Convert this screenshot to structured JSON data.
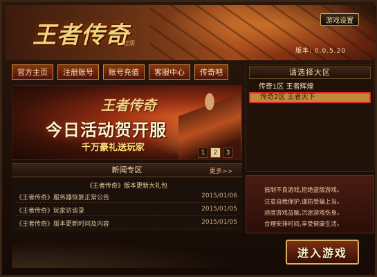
{
  "header": {
    "logo": "王者传奇",
    "logo_sub": "正版",
    "settings_label": "游戏设置",
    "version": "版本: 0.0.5.20"
  },
  "nav": {
    "items": [
      "官方主页",
      "注册账号",
      "账号充值",
      "客服中心",
      "传奇吧"
    ]
  },
  "banner": {
    "logo": "王者传奇",
    "headline": "今日活动贺开服",
    "subtitle": "千万豪礼送玩家",
    "pages": [
      "1",
      "2",
      "3"
    ],
    "active_page": 2
  },
  "news": {
    "title": "新闻专区",
    "more": "更多>>",
    "feature": "《王者传奇》版本更新大礼包",
    "items": [
      {
        "title": "《王者传奇》服务器恢复正常公告",
        "date": "2015/01/06"
      },
      {
        "title": "《王者传奇》玩家访谈录",
        "date": "2015/01/05"
      },
      {
        "title": "《王者传奇》版本更新时间及内容",
        "date": "2015/01/05"
      }
    ]
  },
  "servers": {
    "title": "请选择大区",
    "items": [
      {
        "label": "传奇1区  王者辉煌",
        "selected": false
      },
      {
        "label": "传奇2区  王者天下",
        "selected": true
      }
    ]
  },
  "notice": {
    "lines": [
      "抵制不良游戏,拒绝盗版游戏。",
      "注意自我保护,谨防受骗上当。",
      "适度游戏益脑,沉迷游戏伤身。",
      "合理安排时间,享受健康生活。"
    ]
  },
  "enter_label": "进入游戏",
  "colors": {
    "accent": "#c4883a",
    "selection_border": "#d32a2a",
    "nav_bg": "#8c3312"
  }
}
